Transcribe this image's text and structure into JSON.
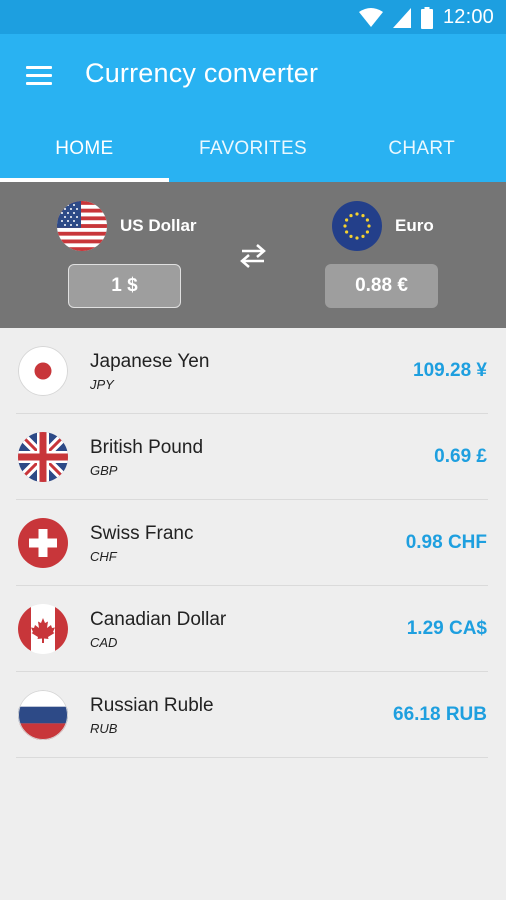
{
  "status_bar": {
    "time": "12:00"
  },
  "app_bar": {
    "title": "Currency converter"
  },
  "tabs": [
    {
      "label": "HOME",
      "active": true
    },
    {
      "label": "FAVORITES",
      "active": false
    },
    {
      "label": "CHART",
      "active": false
    }
  ],
  "converter": {
    "from": {
      "name": "US Dollar",
      "amount": "1 $",
      "flag": "us-flag"
    },
    "to": {
      "name": "Euro",
      "amount": "0.88 €",
      "flag": "eu-flag"
    }
  },
  "currencies": [
    {
      "name": "Japanese Yen",
      "code": "JPY",
      "value": "109.28 ¥",
      "flag": "japan-flag"
    },
    {
      "name": "British Pound",
      "code": "GBP",
      "value": "0.69 £",
      "flag": "uk-flag"
    },
    {
      "name": "Swiss Franc",
      "code": "CHF",
      "value": "0.98 CHF",
      "flag": "swiss-flag"
    },
    {
      "name": "Canadian Dollar",
      "code": "CAD",
      "value": "1.29 CA$",
      "flag": "canada-flag"
    },
    {
      "name": "Russian Ruble",
      "code": "RUB",
      "value": "66.18 RUB",
      "flag": "russia-flag"
    }
  ],
  "colors": {
    "status_bar": "#1d9fe0",
    "app_bar": "#29b2f2",
    "converter_bg": "#757575",
    "amount_box": "#9e9e9e",
    "value_text": "#1e9fdf",
    "list_bg": "#eeeeee"
  }
}
